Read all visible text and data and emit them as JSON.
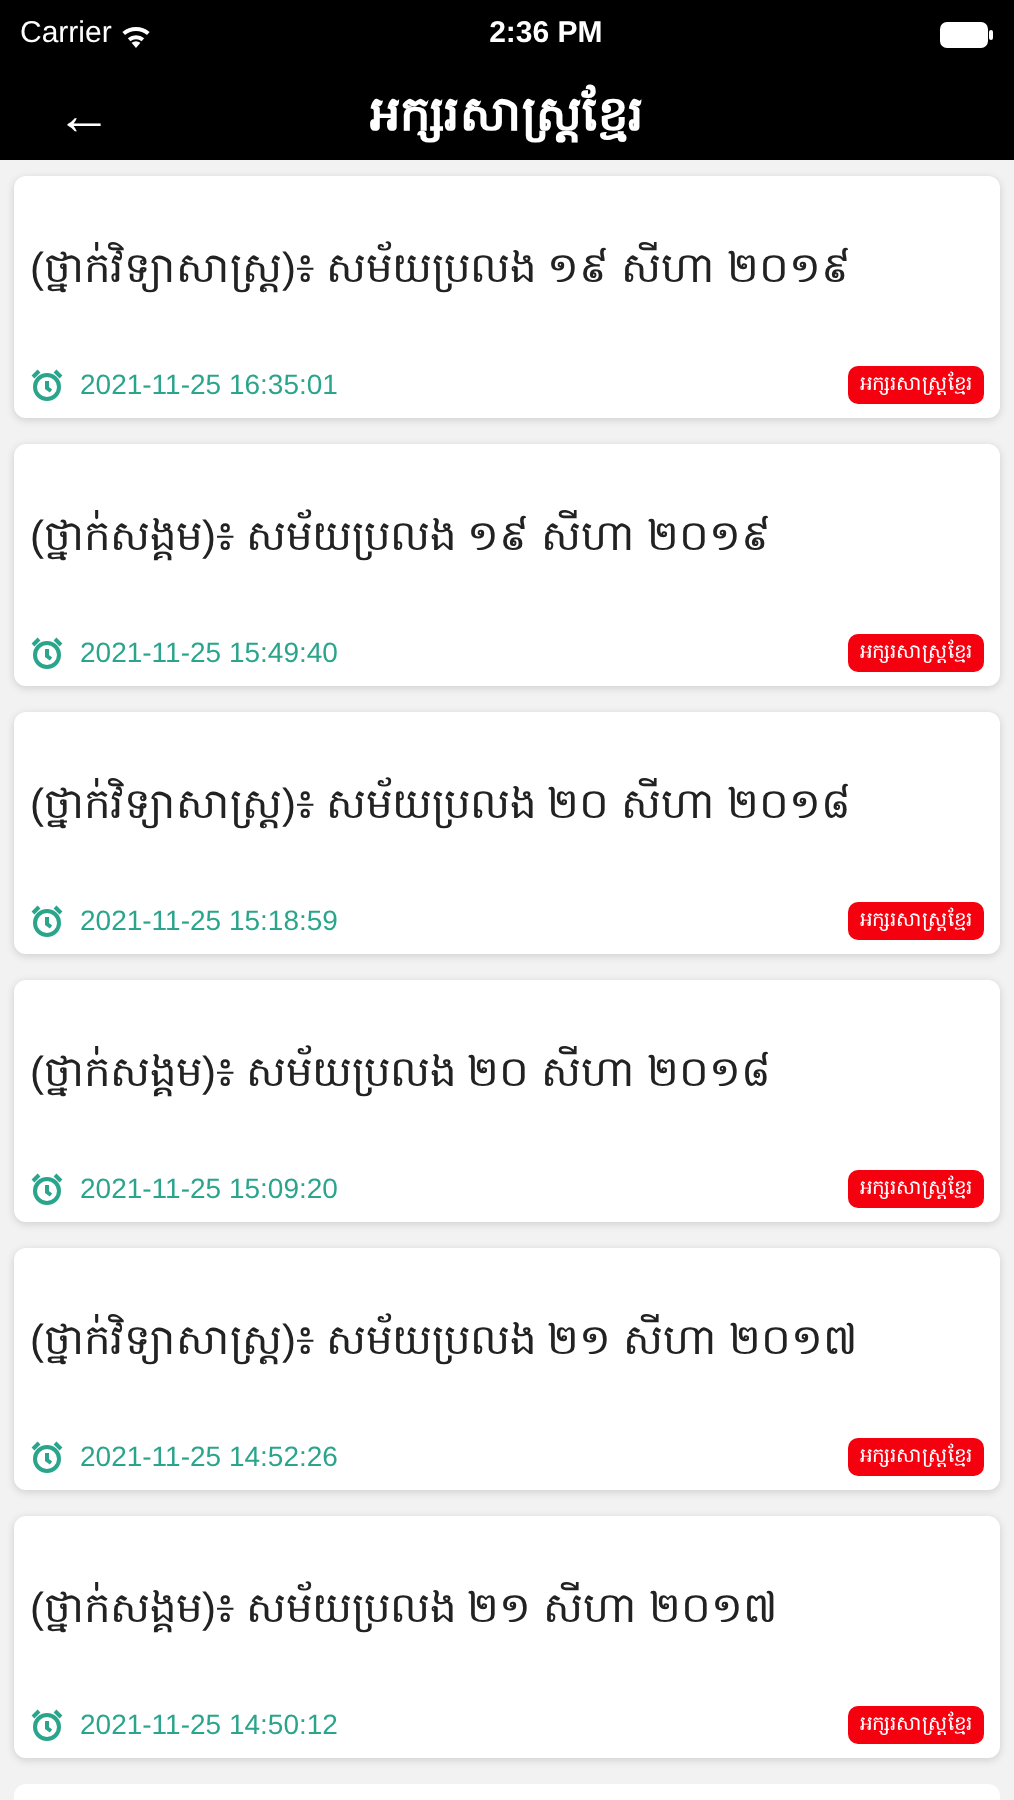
{
  "status_bar": {
    "carrier": "Carrier",
    "time": "2:36 PM"
  },
  "nav": {
    "back": "←",
    "title": "អក្សរសាស្ត្រខ្មែរ"
  },
  "items": [
    {
      "title": "(ថ្នាក់វិទ្យាសាស្ត្រ)៖ សម័យប្រលង ១៩ សីហា ២០១៩",
      "time": "2021-11-25 16:35:01",
      "tag": "អក្សរសាស្ត្រខ្មែរ"
    },
    {
      "title": "(ថ្នាក់សង្គម)៖ សម័យប្រលង ១៩ សីហា ២០១៩",
      "time": "2021-11-25 15:49:40",
      "tag": "អក្សរសាស្ត្រខ្មែរ"
    },
    {
      "title": "(ថ្នាក់វិទ្យាសាស្ត្រ)៖ សម័យប្រលង ២០ សីហា ២០១៨",
      "time": "2021-11-25 15:18:59",
      "tag": "អក្សរសាស្ត្រខ្មែរ"
    },
    {
      "title": "(ថ្នាក់សង្គម)៖ សម័យប្រលង ២០ សីហា ២០១៨",
      "time": "2021-11-25 15:09:20",
      "tag": "អក្សរសាស្ត្រខ្មែរ"
    },
    {
      "title": "(ថ្នាក់វិទ្យាសាស្ត្រ)៖ សម័យប្រលង ២១ សីហា ២០១៧",
      "time": "2021-11-25 14:52:26",
      "tag": "អក្សរសាស្ត្រខ្មែរ"
    },
    {
      "title": "(ថ្នាក់សង្គម)៖ សម័យប្រលង ២១ សីហា ២០១៧",
      "time": "2021-11-25 14:50:12",
      "tag": "អក្សរសាស្ត្រខ្មែរ"
    }
  ]
}
